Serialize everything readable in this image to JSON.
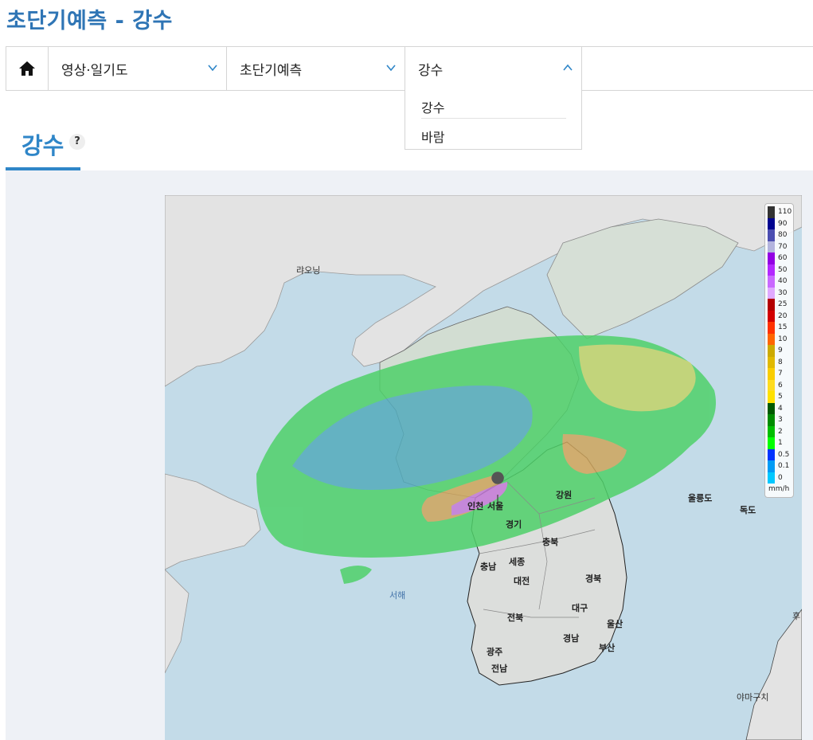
{
  "page": {
    "title": "초단기예측 - 강수"
  },
  "nav": {
    "home_icon": "home-icon",
    "dropdowns": [
      {
        "label": "영상·일기도",
        "state": "collapsed"
      },
      {
        "label": "초단기예측",
        "state": "collapsed"
      },
      {
        "label": "강수",
        "state": "expanded"
      }
    ],
    "menu_items": [
      "강수",
      "바람"
    ]
  },
  "section": {
    "title": "강수",
    "help_label": "?"
  },
  "map": {
    "labels": {
      "liaoning": "랴오닝",
      "seoul": "서울",
      "incheon": "인천",
      "gyeonggi": "경기",
      "gangwon": "강원",
      "chungbuk": "충북",
      "chungnam": "충남",
      "sejong": "세종",
      "daejeon": "대전",
      "gyeongbuk": "경북",
      "yellow_sea": "서해",
      "jeonbuk": "전북",
      "daegu": "대구",
      "ulsan": "울산",
      "gyeongnam": "경남",
      "busan": "부산",
      "gwangju": "광주",
      "jeonnam": "전남",
      "ulleungdo": "울릉도",
      "dokdo": "독도",
      "yamaguchi": "야마구치",
      "hu": "후"
    },
    "legend": {
      "unit": "mm/h",
      "items": [
        {
          "label": "110",
          "color": "#333333"
        },
        {
          "label": "90",
          "color": "#000390"
        },
        {
          "label": "80",
          "color": "#4c4eb1"
        },
        {
          "label": "70",
          "color": "#b3b4de"
        },
        {
          "label": "60",
          "color": "#9300e4"
        },
        {
          "label": "50",
          "color": "#b329ff"
        },
        {
          "label": "40",
          "color": "#c969ff"
        },
        {
          "label": "30",
          "color": "#e0a9ff"
        },
        {
          "label": "25",
          "color": "#b40000"
        },
        {
          "label": "20",
          "color": "#d20000"
        },
        {
          "label": "15",
          "color": "#ff3200"
        },
        {
          "label": "10",
          "color": "#ff6600"
        },
        {
          "label": "9",
          "color": "#ccaa00"
        },
        {
          "label": "8",
          "color": "#e0b900"
        },
        {
          "label": "7",
          "color": "#f9cd00"
        },
        {
          "label": "6",
          "color": "#ffdc1f"
        },
        {
          "label": "5",
          "color": "#ffe100"
        },
        {
          "label": "4",
          "color": "#005a00"
        },
        {
          "label": "3",
          "color": "#008c00"
        },
        {
          "label": "2",
          "color": "#00be00"
        },
        {
          "label": "1",
          "color": "#00ff00"
        },
        {
          "label": "0.5",
          "color": "#0033ff"
        },
        {
          "label": "0.1",
          "color": "#009bf5"
        },
        {
          "label": "0",
          "color": "#00c8ff"
        }
      ]
    },
    "colors": {
      "sea": "#c3dbe8",
      "land_china": "#e3e3e3",
      "land_nk": "#d2ddd2",
      "land_sk": "#dcdedc",
      "rain_light": "#4fd16a",
      "rain_blue": "#5a8cff",
      "rain_yellow": "#e8d36a",
      "rain_orange": "#ee9a5a",
      "rain_purple": "#c57ad8"
    }
  }
}
